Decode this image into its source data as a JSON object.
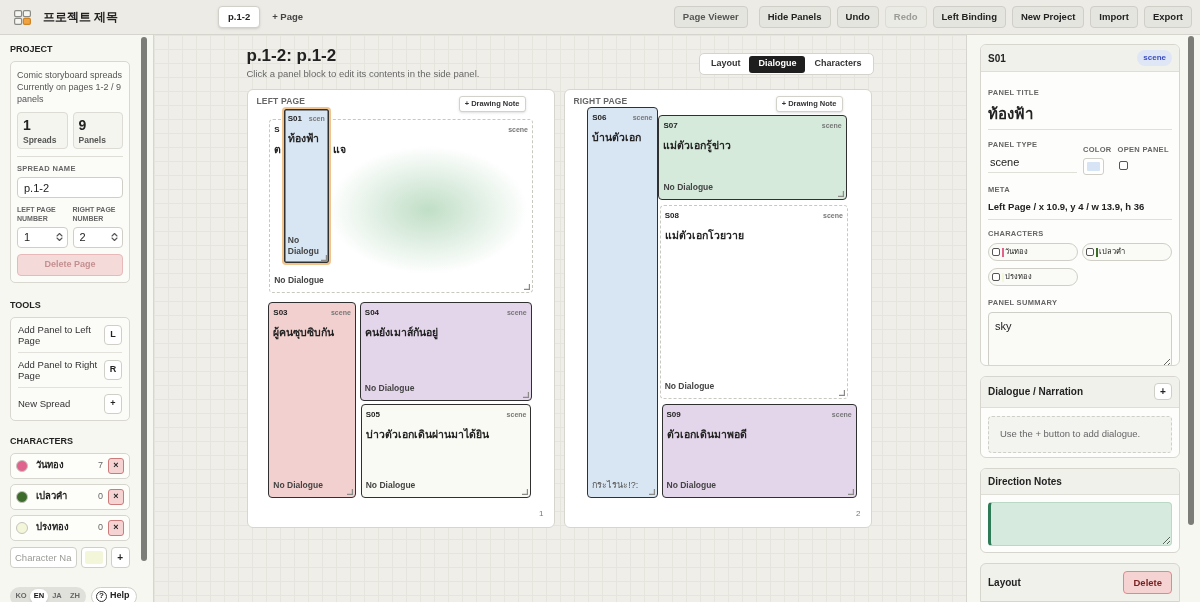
{
  "app": {
    "title": "프로젝트 제목"
  },
  "spread_tabs": [
    {
      "label": "p.1-2",
      "selected": true
    }
  ],
  "add_page": "+ Page",
  "toolbar": [
    {
      "label": "Page Viewer",
      "kind": "view",
      "disabled": false
    },
    {
      "label": "Hide Panels",
      "kind": "action",
      "disabled": false
    },
    {
      "label": "Undo",
      "kind": "action",
      "disabled": false
    },
    {
      "label": "Redo",
      "kind": "action",
      "disabled": true
    },
    {
      "label": "Left Binding",
      "kind": "action",
      "disabled": false
    },
    {
      "label": "New Project",
      "kind": "action",
      "disabled": false
    },
    {
      "label": "Import",
      "kind": "action",
      "disabled": false
    },
    {
      "label": "Export",
      "kind": "action",
      "disabled": false
    }
  ],
  "project": {
    "heading": "PROJECT",
    "description": [
      "Comic storyboard spreads",
      "Currently on pages 1-2 / 9 panels"
    ],
    "stats": [
      {
        "value": "1",
        "label": "Spreads"
      },
      {
        "value": "9",
        "label": "Panels"
      }
    ],
    "spread_name": {
      "label": "SPREAD NAME",
      "value": "p.1-2"
    },
    "page_numbers": [
      {
        "label": "LEFT PAGE NUMBER",
        "value": "1"
      },
      {
        "label": "RIGHT PAGE NUMBER",
        "value": "2"
      }
    ],
    "delete_button": {
      "label": "Delete Page",
      "disabled": true
    }
  },
  "tools": {
    "heading": "TOOLS",
    "items": [
      {
        "label": "Add Panel to Left Page",
        "key": "L"
      },
      {
        "label": "Add Panel to Right Page",
        "key": "R"
      },
      {
        "label": "New Spread",
        "key": "+"
      }
    ]
  },
  "characters": {
    "heading": "CHARACTERS",
    "items": [
      {
        "name": "วันทอง",
        "color": "#e0638d",
        "count": "7",
        "remove": "×"
      },
      {
        "name": "เปลวคำ",
        "color": "#3d6b2c",
        "count": "0",
        "remove": "×"
      },
      {
        "name": "ปรงทอง",
        "color": "#f4f6d9",
        "count": "0",
        "remove": "×"
      }
    ],
    "new_character": {
      "placeholder": "Character Na",
      "color": "#f4f6d9",
      "add": "+"
    }
  },
  "languages": [
    {
      "label": "KO",
      "selected": false
    },
    {
      "label": "EN",
      "selected": true
    },
    {
      "label": "JA",
      "selected": false
    },
    {
      "label": "ZH",
      "selected": false
    }
  ],
  "help": {
    "icon": "?",
    "label": "Help"
  },
  "canvas": {
    "title": "p.1-2: p.1-2",
    "hint": "Click a panel block to edit its contents in the side panel.",
    "modes": [
      {
        "label": "Layout",
        "selected": false
      },
      {
        "label": "Dialogue",
        "selected": true
      },
      {
        "label": "Characters",
        "selected": false
      }
    ],
    "pages": [
      {
        "label": "LEFT PAGE",
        "note_button": "+ Drawing Note",
        "number": "1",
        "panels": [
          {
            "id": "S01",
            "type": "scen",
            "kind": "framed",
            "title": "ท้องฟ้า",
            "dialogue": {
              "kind": "empty",
              "text": "No Dialogu"
            },
            "color": "#d8e5f3",
            "selected": true
          },
          {
            "id": "S",
            "type": "scene",
            "kind": "open",
            "title_parts": [
              "ต",
              "แจ"
            ],
            "sketch": {
              "kind": "blur"
            },
            "dialogue": {
              "kind": "empty",
              "text": "No Dialogue"
            },
            "color": "#ffffff",
            "selected": false
          },
          {
            "id": "S03",
            "type": "scene",
            "kind": "framed",
            "title": "ผู้คนซุบซิบกัน",
            "dialogue": {
              "kind": "empty",
              "text": "No Dialogue"
            },
            "color": "#f2d0cf",
            "selected": false
          },
          {
            "id": "S04",
            "type": "scene",
            "kind": "framed",
            "title": "คนยังเมาส์กันอยู่",
            "dialogue": {
              "kind": "empty",
              "text": "No Dialogue"
            },
            "color": "#e3d5ea",
            "selected": false
          },
          {
            "id": "S05",
            "type": "scene",
            "kind": "framed",
            "title": "บ่าวตัวเอกเดินผ่านมาได้ยิน",
            "dialogue": {
              "kind": "empty",
              "text": "No Dialogue"
            },
            "color": "#fafaf4",
            "selected": false
          }
        ]
      },
      {
        "label": "RIGHT PAGE",
        "note_button": "+ Drawing Note",
        "number": "2",
        "panels": [
          {
            "id": "S06",
            "type": "scene",
            "kind": "framed",
            "title": "บ้านตัวเอก",
            "dialogue": {
              "kind": "line",
              "text": "กระไรนะ!?:"
            },
            "color": "#d8e5f3",
            "selected": false
          },
          {
            "id": "S07",
            "type": "scene",
            "kind": "framed",
            "title": "แม่ตัวเอกรู้ข่าว",
            "dialogue": {
              "kind": "empty",
              "text": "No Dialogue"
            },
            "color": "#d5eadb",
            "selected": false
          },
          {
            "id": "S08",
            "type": "scene",
            "kind": "open",
            "title": "แม่ตัวเอกโวยวาย",
            "dialogue": {
              "kind": "empty",
              "text": "No Dialogue"
            },
            "color": "#ffffff",
            "selected": false
          },
          {
            "id": "S09",
            "type": "scene",
            "kind": "framed",
            "title": "ตัวเอกเดินมาพอดี",
            "dialogue": {
              "kind": "empty",
              "text": "No Dialogue"
            },
            "color": "#e3d5ea",
            "selected": false
          }
        ]
      }
    ]
  },
  "inspector": {
    "id": "S01",
    "type": "scene",
    "title_label": "PANEL TITLE",
    "title": "ท้องฟ้า",
    "type_label": "PANEL TYPE",
    "type_value": "scene",
    "color_label": "COLOR",
    "color": "#d6e4f5",
    "open_label": "OPEN PANEL",
    "open_panel": false,
    "meta_label": "META",
    "meta": "Left Page / x 10.9, y 4 / w 13.9, h 36",
    "characters_label": "CHARACTERS",
    "characters": [
      {
        "name": "วันทอง",
        "color": "#e0638d",
        "checked": false
      },
      {
        "name": "เปลวคำ",
        "color": "#3d6b2c",
        "checked": false
      },
      {
        "name": "ปรงทอง",
        "color": "#f4f6d9",
        "checked": false
      }
    ],
    "summary_label": "PANEL SUMMARY",
    "summary": "sky"
  },
  "dialogue": {
    "title": "Dialogue / Narration",
    "add": "+",
    "empty": "Use the + button to add dialogue."
  },
  "direction_notes": {
    "title": "Direction Notes"
  },
  "layout": {
    "title": "Layout",
    "delete": "Delete"
  }
}
